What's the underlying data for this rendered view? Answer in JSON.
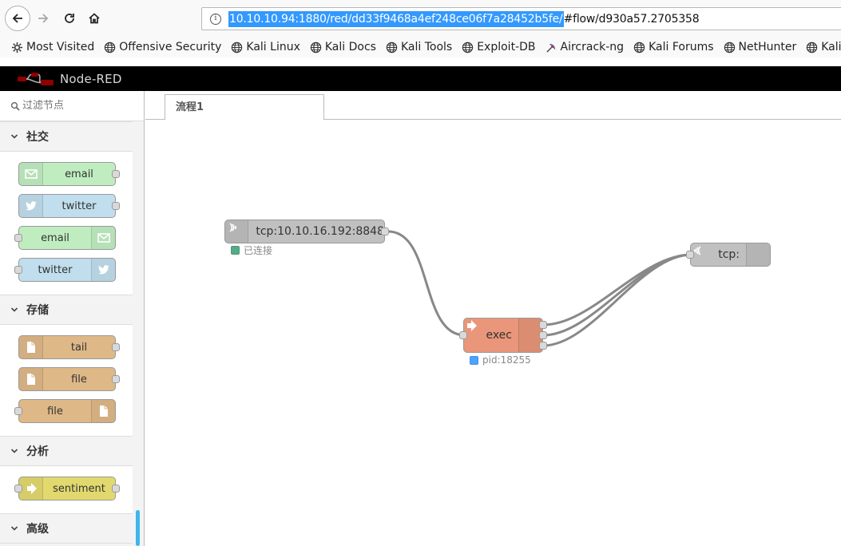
{
  "browser": {
    "url_selected": "10.10.10.94:1880/red/dd33f9468a4ef248ce06f7a28452b5fe/",
    "url_rest": "#flow/d930a57.2705358",
    "bookmarks": [
      {
        "label": "Most Visited",
        "icon": "gear-icon"
      },
      {
        "label": "Offensive Security",
        "icon": "globe-icon"
      },
      {
        "label": "Kali Linux",
        "icon": "globe-icon"
      },
      {
        "label": "Kali Docs",
        "icon": "globe-icon"
      },
      {
        "label": "Kali Tools",
        "icon": "globe-icon"
      },
      {
        "label": "Exploit-DB",
        "icon": "globe-icon"
      },
      {
        "label": "Aircrack-ng",
        "icon": "satellite-icon"
      },
      {
        "label": "Kali Forums",
        "icon": "globe-icon"
      },
      {
        "label": "NetHunter",
        "icon": "globe-icon"
      },
      {
        "label": "Kali Training",
        "icon": "globe-icon"
      }
    ]
  },
  "app": {
    "title": "Node-RED"
  },
  "palette": {
    "search_placeholder": "过滤节点",
    "categories": [
      {
        "name": "社交",
        "nodes": [
          {
            "label": "email",
            "color": "#c0edc0",
            "icon": "envelope-icon",
            "side": "left"
          },
          {
            "label": "twitter",
            "color": "#c0deed",
            "icon": "twitter-icon",
            "side": "left"
          },
          {
            "label": "email",
            "color": "#c0edc0",
            "icon": "envelope-icon",
            "side": "right"
          },
          {
            "label": "twitter",
            "color": "#c0deed",
            "icon": "twitter-icon",
            "side": "right"
          }
        ]
      },
      {
        "name": "存储",
        "nodes": [
          {
            "label": "tail",
            "color": "#deb887",
            "icon": "file-icon",
            "side": "left"
          },
          {
            "label": "file",
            "color": "#deb887",
            "icon": "file-icon",
            "side": "left"
          },
          {
            "label": "file",
            "color": "#deb887",
            "icon": "file-icon",
            "side": "right"
          }
        ]
      },
      {
        "name": "分析",
        "nodes": [
          {
            "label": "sentiment",
            "color": "#e2d96e",
            "icon": "arrow-in-icon",
            "side": "left"
          }
        ]
      },
      {
        "name": "高级",
        "nodes": []
      }
    ]
  },
  "workspace": {
    "tab": "流程1",
    "nodes": {
      "tcp_in": {
        "label": "tcp:10.10.16.192:8848",
        "status": "已连接",
        "status_color": "#5a8"
      },
      "exec": {
        "label": "exec",
        "status": "pid:18255",
        "status_color": "#4da3ff"
      },
      "tcp_out": {
        "label": "tcp:"
      }
    }
  }
}
